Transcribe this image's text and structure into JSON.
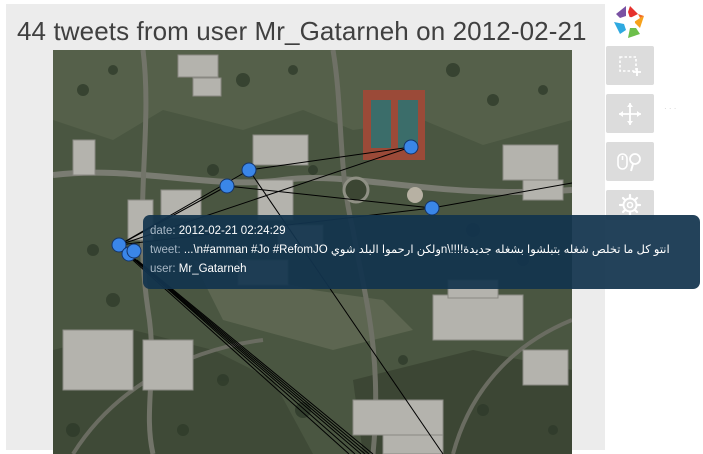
{
  "page": {
    "title": "44 tweets from user Mr_Gatarneh on 2012-02-21"
  },
  "toolbar": {
    "logo_icon": "plot-logo-icon",
    "tools": [
      {
        "name": "box-select",
        "icon": "box-select-icon",
        "active": false
      },
      {
        "name": "pan",
        "icon": "pan-move-icon",
        "active": false
      },
      {
        "name": "wheel-zoom",
        "icon": "mouse-wheel-zoom-icon",
        "active": false
      },
      {
        "name": "settings",
        "icon": "gear-icon",
        "active": false
      }
    ]
  },
  "tooltip": {
    "date_label": "date:",
    "date_value": "2012-02-21 02:24:29",
    "tweet_label": "tweet:",
    "tweet_value": "...\\n#amman #Jo #RefomJO ولكن ارحموا البلد شويn\\!!!!انتو كل ما تخلص شغله بتبلشوا بشغله جديدة",
    "user_label": "user:",
    "user_value": "Mr_Gatarneh"
  },
  "colors": {
    "panel_bg": "#ececec",
    "point_fill": "#3a86e8",
    "point_stroke": "#14356a",
    "line": "#000000",
    "tooltip_bg": "#12344e",
    "button_bg": "#dcdcdc"
  }
}
